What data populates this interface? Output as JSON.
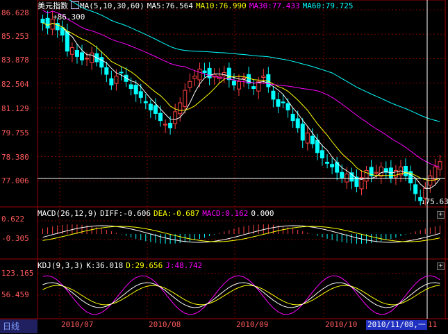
{
  "main_header": {
    "title": "美元指数",
    "ma_label": "MA(5,10,30,60)",
    "ma5": "MA5:76.564",
    "ma10": "MA10:76.990",
    "ma30": "MA30:77.433",
    "ma60": "MA60:79.725"
  },
  "main_axis": [
    "86.628",
    "85.253",
    "83.878",
    "82.504",
    "81.129",
    "79.755",
    "78.380",
    "77.006"
  ],
  "high_marker": "86.300",
  "low_marker": "75.63",
  "macd_header": {
    "label": "MACD(26,12,9)",
    "diff": "DIFF:-0.606",
    "dea": "DEA:-0.687",
    "macd": "MACD:0.162",
    "zero": "0.000"
  },
  "macd_axis": [
    "0.622",
    "-0.305"
  ],
  "kdj_header": {
    "label": "KDJ(9,3,3)",
    "k": "K:36.018",
    "d": "D:29.656",
    "j": "J:48.742"
  },
  "kdj_axis": [
    "123.165",
    "56.459"
  ],
  "period_label": "日线",
  "x_axis": [
    "2010/07",
    "2010/08",
    "2010/09",
    "2010/10"
  ],
  "cursor_date": "2010/11/08,一",
  "cursor_tail": "11",
  "colors": {
    "ma5": "#ffffff",
    "ma10": "#ffff00",
    "ma30": "#ff00ff",
    "ma60": "#00ffff",
    "up": "#ff4040",
    "down": "#00ffff",
    "axis_text": "#ff5a5a",
    "grid": "#800000"
  },
  "chart_data": {
    "type": "line",
    "closes": [
      85.9,
      85.6,
      86.1,
      85.5,
      85.2,
      84.3,
      84.5,
      84.0,
      83.8,
      83.9,
      84.2,
      83.7,
      83.4,
      83.0,
      82.4,
      82.9,
      83.1,
      82.6,
      82.2,
      81.9,
      81.7,
      81.4,
      81.0,
      80.8,
      80.4,
      80.2,
      80.0,
      80.9,
      81.4,
      82.1,
      82.6,
      82.9,
      83.3,
      83.1,
      82.8,
      83.0,
      82.9,
      83.1,
      82.7,
      82.4,
      82.6,
      82.8,
      82.5,
      82.2,
      82.6,
      82.9,
      82.3,
      81.6,
      81.2,
      81.4,
      81.0,
      80.4,
      80.0,
      79.3,
      79.7,
      79.1,
      78.6,
      78.3,
      78.0,
      77.8,
      77.5,
      77.2,
      77.4,
      77.0,
      76.7,
      77.2,
      77.6,
      77.3,
      77.5,
      77.8,
      77.5,
      77.2,
      77.6,
      77.8,
      77.3,
      76.9,
      76.3,
      75.9,
      76.6,
      77.3,
      77.8,
      78.1
    ],
    "ma_periods": [
      5,
      10,
      30,
      60
    ],
    "ylim": [
      75.631,
      86.628
    ]
  }
}
